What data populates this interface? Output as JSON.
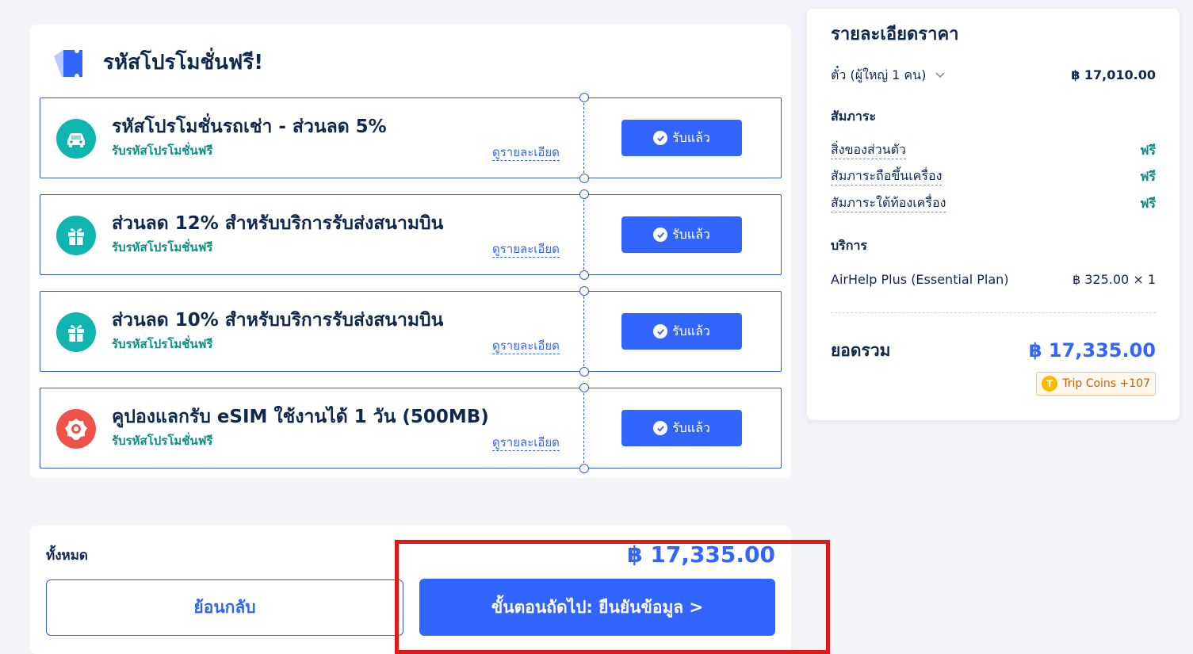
{
  "promo": {
    "title": "รหัสโปรโมชั่นฟรี!",
    "coupons": [
      {
        "title": "รหัสโปรโมชั่นรถเช่า - ส่วนลด 5%",
        "subtitle": "รับรหัสโปรโมชั่นฟรี",
        "details_link": "ดูรายละเอียด",
        "button_label": "รับแล้ว",
        "icon": "car-icon",
        "icon_color": "#11b5b0"
      },
      {
        "title": "ส่วนลด 12% สำหรับบริการรับส่งสนามบิน",
        "subtitle": "รับรหัสโปรโมชั่นฟรี",
        "details_link": "ดูรายละเอียด",
        "button_label": "รับแล้ว",
        "icon": "gift-icon",
        "icon_color": "#11b5b0"
      },
      {
        "title": "ส่วนลด 10% สำหรับบริการรับส่งสนามบิน",
        "subtitle": "รับรหัสโปรโมชั่นฟรี",
        "details_link": "ดูรายละเอียด",
        "button_label": "รับแล้ว",
        "icon": "gift-icon",
        "icon_color": "#11b5b0"
      },
      {
        "title": "คูปองแลกรับ eSIM ใช้งานได้ 1 วัน (500MB)",
        "subtitle": "รับรหัสโปรโมชั่นฟรี",
        "details_link": "ดูรายละเอียด",
        "button_label": "รับแล้ว",
        "icon": "esim-icon",
        "icon_color": "#f0524a"
      }
    ]
  },
  "price": {
    "title": "รายละเอียดราคา",
    "ticket_label": "ตั๋ว (ผู้ใหญ่ 1 คน)",
    "ticket_value": "฿ 17,010.00",
    "baggage_heading": "สัมภาระ",
    "baggage": [
      {
        "label": "สิ่งของส่วนตัว",
        "value": "ฟรี"
      },
      {
        "label": "สัมภาระถือขึ้นเครื่อง",
        "value": "ฟรี"
      },
      {
        "label": "สัมภาระใต้ท้องเครื่อง",
        "value": "ฟรี"
      }
    ],
    "services_heading": "บริการ",
    "services": [
      {
        "label": "AirHelp Plus (Essential Plan)",
        "value": "฿ 325.00 × 1"
      }
    ],
    "total_label": "ยอดรวม",
    "total_value": "฿ 17,335.00",
    "trip_coins": "Trip Coins +107",
    "coin_glyph": "T"
  },
  "footer": {
    "total_label": "ทั้งหมด",
    "total_value": "฿ 17,335.00",
    "back_label": "ย้อนกลับ",
    "next_label": "ขั้นตอนถัดไป: ยืนยันข้อมูล >"
  },
  "colors": {
    "accent": "#3264ff",
    "free_green": "#0a8f83",
    "highlight": "#e01818"
  }
}
